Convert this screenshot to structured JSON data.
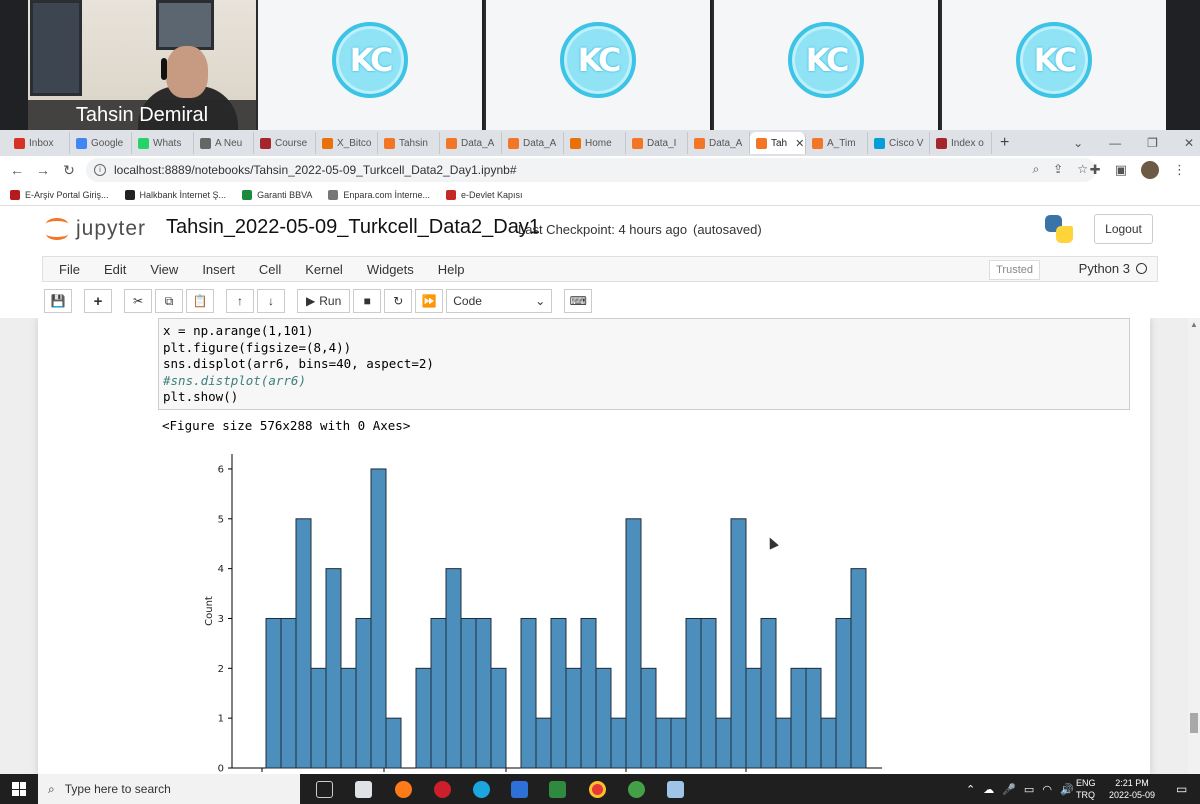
{
  "call": {
    "participant_name": "Tahsin Demiral",
    "logo_text": "KC"
  },
  "browser": {
    "tabs": [
      {
        "label": "Inbox",
        "color": "#d93025"
      },
      {
        "label": "Google",
        "color": "#4285f4"
      },
      {
        "label": "Whats",
        "color": "#25d366"
      },
      {
        "label": "A Neu",
        "color": "#666666"
      },
      {
        "label": "Course",
        "color": "#a4262c"
      },
      {
        "label": "X_Bitco",
        "color": "#e8710a"
      },
      {
        "label": "Tahsin",
        "color": "#f37626"
      },
      {
        "label": "Data_A",
        "color": "#f37626"
      },
      {
        "label": "Data_A",
        "color": "#f37626"
      },
      {
        "label": "Home",
        "color": "#e8710a"
      },
      {
        "label": "Data_I",
        "color": "#f37626"
      },
      {
        "label": "Data_A",
        "color": "#f37626"
      },
      {
        "label": "Tah",
        "color": "#f37626",
        "active": true
      },
      {
        "label": "A_Tim",
        "color": "#f37626"
      },
      {
        "label": "Cisco V",
        "color": "#049fd9"
      },
      {
        "label": "Index o",
        "color": "#a4262c"
      }
    ],
    "tab_close_glyph": "✕",
    "new_tab_glyph": "+",
    "window_controls": [
      "⌄",
      "—",
      "❐",
      "✕"
    ],
    "url": "localhost:8889/notebooks/Tahsin_2022-05-09_Turkcell_Data2_Day1.ipynb#",
    "bookmarks": [
      {
        "label": "E-Arşiv Portal Giriş...",
        "color": "#b71c1c"
      },
      {
        "label": "Halkbank İnternet Ş...",
        "color": "#222222"
      },
      {
        "label": "Garanti BBVA",
        "color": "#1b8a3a"
      },
      {
        "label": "Enpara.com İnterne...",
        "color": "#777777"
      },
      {
        "label": "e-Devlet Kapısı",
        "color": "#c62828"
      }
    ]
  },
  "jupyter": {
    "logo_word": "jupyter",
    "notebook_name": "Tahsin_2022-05-09_Turkcell_Data2_Day1",
    "checkpoint": "Last Checkpoint: 4 hours ago",
    "autosave": "(autosaved)",
    "logout_label": "Logout",
    "menu": [
      "File",
      "Edit",
      "View",
      "Insert",
      "Cell",
      "Kernel",
      "Widgets",
      "Help"
    ],
    "trusted_label": "Trusted",
    "kernel_label": "Python 3",
    "toolbar": {
      "run_label": "Run",
      "cell_type": "Code"
    },
    "code_lines": [
      "x = np.arange(1,101)",
      "plt.figure(figsize=(8,4))",
      "sns.displot(arr6, bins=40, aspect=2)",
      "#sns.distplot(arr6)",
      "plt.show()"
    ],
    "output_text": "<Figure size 576x288 with 0 Axes>"
  },
  "chart_data": {
    "type": "bar",
    "ylabel": "Count",
    "ylim": [
      0,
      6.3
    ],
    "yticks": [
      0,
      1,
      2,
      3,
      4,
      5,
      6
    ],
    "values": [
      3,
      3,
      5,
      2,
      4,
      2,
      3,
      6,
      1,
      0,
      2,
      3,
      4,
      3,
      3,
      2,
      0,
      3,
      1,
      3,
      2,
      3,
      2,
      1,
      5,
      2,
      1,
      1,
      3,
      3,
      1,
      5,
      2,
      3,
      1,
      2,
      2,
      1,
      3,
      4
    ],
    "bar_color": "#4c8fbd",
    "edge_color": "#1f2d3a"
  },
  "taskbar": {
    "search_placeholder": "Type here to search",
    "language": [
      "ENG",
      "TRQ"
    ],
    "time": "2:21 PM",
    "date": "2022-05-09"
  }
}
